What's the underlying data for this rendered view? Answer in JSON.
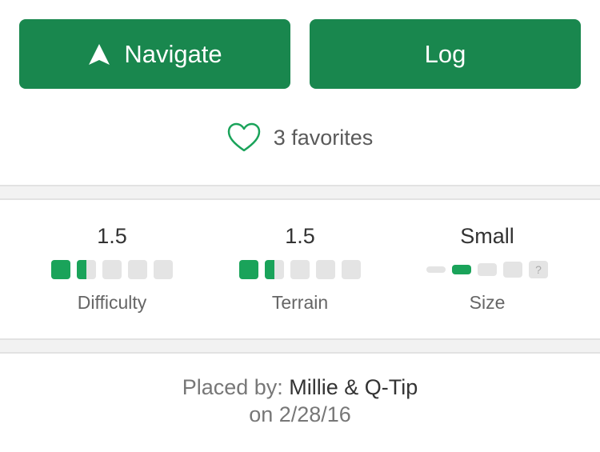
{
  "actions": {
    "navigate_label": "Navigate",
    "log_label": "Log"
  },
  "favorites": {
    "text": "3 favorites"
  },
  "ratings": {
    "difficulty": {
      "value": "1.5",
      "label": "Difficulty",
      "fill": 1.5,
      "max": 5
    },
    "terrain": {
      "value": "1.5",
      "label": "Terrain",
      "fill": 1.5,
      "max": 5
    },
    "size": {
      "value": "Small",
      "label": "Size",
      "selected_index": 2,
      "unknown_glyph": "?"
    }
  },
  "placed": {
    "prefix": "Placed by:",
    "owner": "Millie & Q-Tip",
    "date": "on 2/28/16"
  },
  "colors": {
    "accent": "#19874e",
    "rating_fill": "#1aa35a"
  },
  "icons": {
    "navigate": "navigation-arrow-icon",
    "favorite": "heart-outline-icon"
  }
}
